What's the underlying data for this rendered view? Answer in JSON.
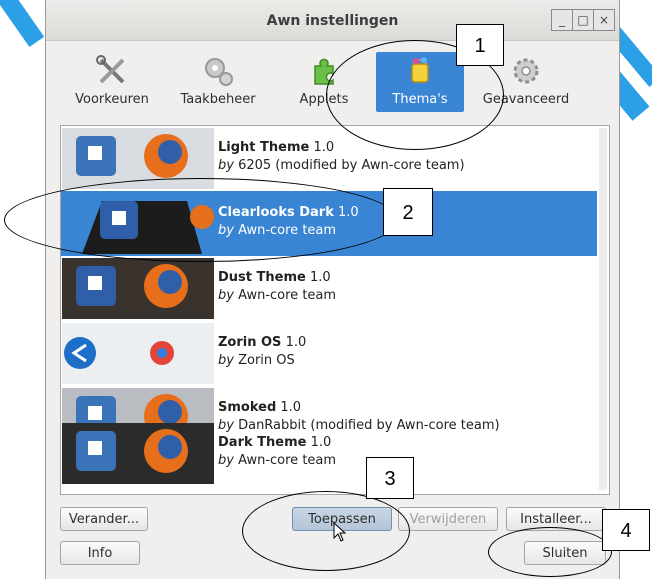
{
  "window": {
    "title": "Awn instellingen"
  },
  "wm": {
    "minimize": "_",
    "maximize": "□",
    "close": "×"
  },
  "toolbar": {
    "items": [
      {
        "label": "Voorkeuren",
        "icon": "tools-icon"
      },
      {
        "label": "Taakbeheer",
        "icon": "gears-icon"
      },
      {
        "label": "Applets",
        "icon": "puzzle-icon"
      },
      {
        "label": "Thema's",
        "icon": "paint-bucket-icon",
        "active": true
      },
      {
        "label": "Geavanceerd",
        "icon": "gear-icon"
      }
    ]
  },
  "themes": [
    {
      "name": "Light Theme",
      "version": "1.0",
      "by": "by",
      "author": "6205 (modified by Awn-core team)"
    },
    {
      "name": "Clearlooks Dark",
      "version": "1.0",
      "by": "by",
      "author": "Awn-core team",
      "selected": true
    },
    {
      "name": "Dust Theme",
      "version": "1.0",
      "by": "by",
      "author": "Awn-core team"
    },
    {
      "name": "Zorin OS",
      "version": "1.0",
      "by": "by",
      "author": "Zorin OS"
    },
    {
      "name": "Smoked",
      "version": "1.0",
      "by": "by",
      "author": "DanRabbit (modified by Awn-core team)"
    },
    {
      "name": "Dark Theme",
      "version": "1.0",
      "by": "by",
      "author": "Awn-core team"
    }
  ],
  "buttons": {
    "change": "Verander...",
    "apply": "Toepassen",
    "remove": "Verwijderen",
    "install": "Installeer...",
    "info": "Info",
    "close": "Sluiten"
  },
  "callouts": {
    "c1": "1",
    "c2": "2",
    "c3": "3",
    "c4": "4"
  },
  "colors": {
    "selection": "#3a85d3",
    "accent_stripes": "#2ba0e6"
  }
}
